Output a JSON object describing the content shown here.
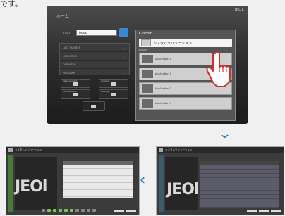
{
  "caption_fragment": "です。",
  "main_screen": {
    "brand": "JEOL",
    "home_title": "ホーム",
    "user_label": "User",
    "user_value": "bdusr",
    "info_rows": [
      {
        "label": "LAST NUMBER",
        "value": "----"
      },
      {
        "label": "LOGIN TIME",
        "value": "----"
      },
      {
        "label": "OPERATOR",
        "value": "----"
      },
      {
        "label": "PROGRAM",
        "value": "----"
      }
    ],
    "buttons": [
      "Measurement",
      "Analysis",
      "Maintenance",
      "Setting"
    ],
    "custom_panel": {
      "header": "Custom",
      "custom_item": "カスタムソリューション",
      "sub_header": "BioMS",
      "apps": [
        "Application 1",
        "Application 2",
        "Application 3",
        "Application 4"
      ]
    }
  },
  "thumbnails": {
    "left": {
      "title": "カスタムソリューション",
      "logo": "JEOl"
    },
    "right": {
      "title": "カスタムソリューション",
      "logo": "JEOl"
    }
  },
  "colors": {
    "accent": "#1f7fc9",
    "progress_green": "#7fc45a"
  }
}
